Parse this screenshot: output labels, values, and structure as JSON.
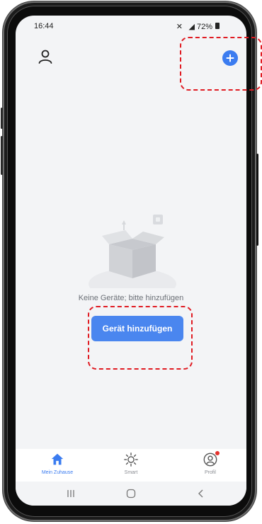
{
  "status_bar": {
    "time": "16:44",
    "indicators": "✕  ◢ 72%",
    "battery_icon": "battery-icon"
  },
  "top_bar": {
    "user_icon": "user-icon",
    "add_icon": "plus-circle-icon"
  },
  "empty_state": {
    "illustration": "open-box-icon",
    "message": "Keine Geräte; bitte hinzufügen",
    "button_label": "Gerät hinzufügen"
  },
  "tabs": [
    {
      "label": "Mein Zuhause",
      "icon": "home-icon",
      "active": true
    },
    {
      "label": "Smart",
      "icon": "sun-icon",
      "active": false
    },
    {
      "label": "Profil",
      "icon": "profile-icon",
      "active": false,
      "badge": true
    }
  ],
  "nav_bar": {
    "recents_icon": "recents-icon",
    "home_icon": "home-nav-icon",
    "back_icon": "back-icon"
  },
  "colors": {
    "accent": "#3b7cf0",
    "button": "#4a86ef",
    "highlight": "#e01b22",
    "screen_bg": "#f3f4f6",
    "badge": "#e5322d"
  }
}
